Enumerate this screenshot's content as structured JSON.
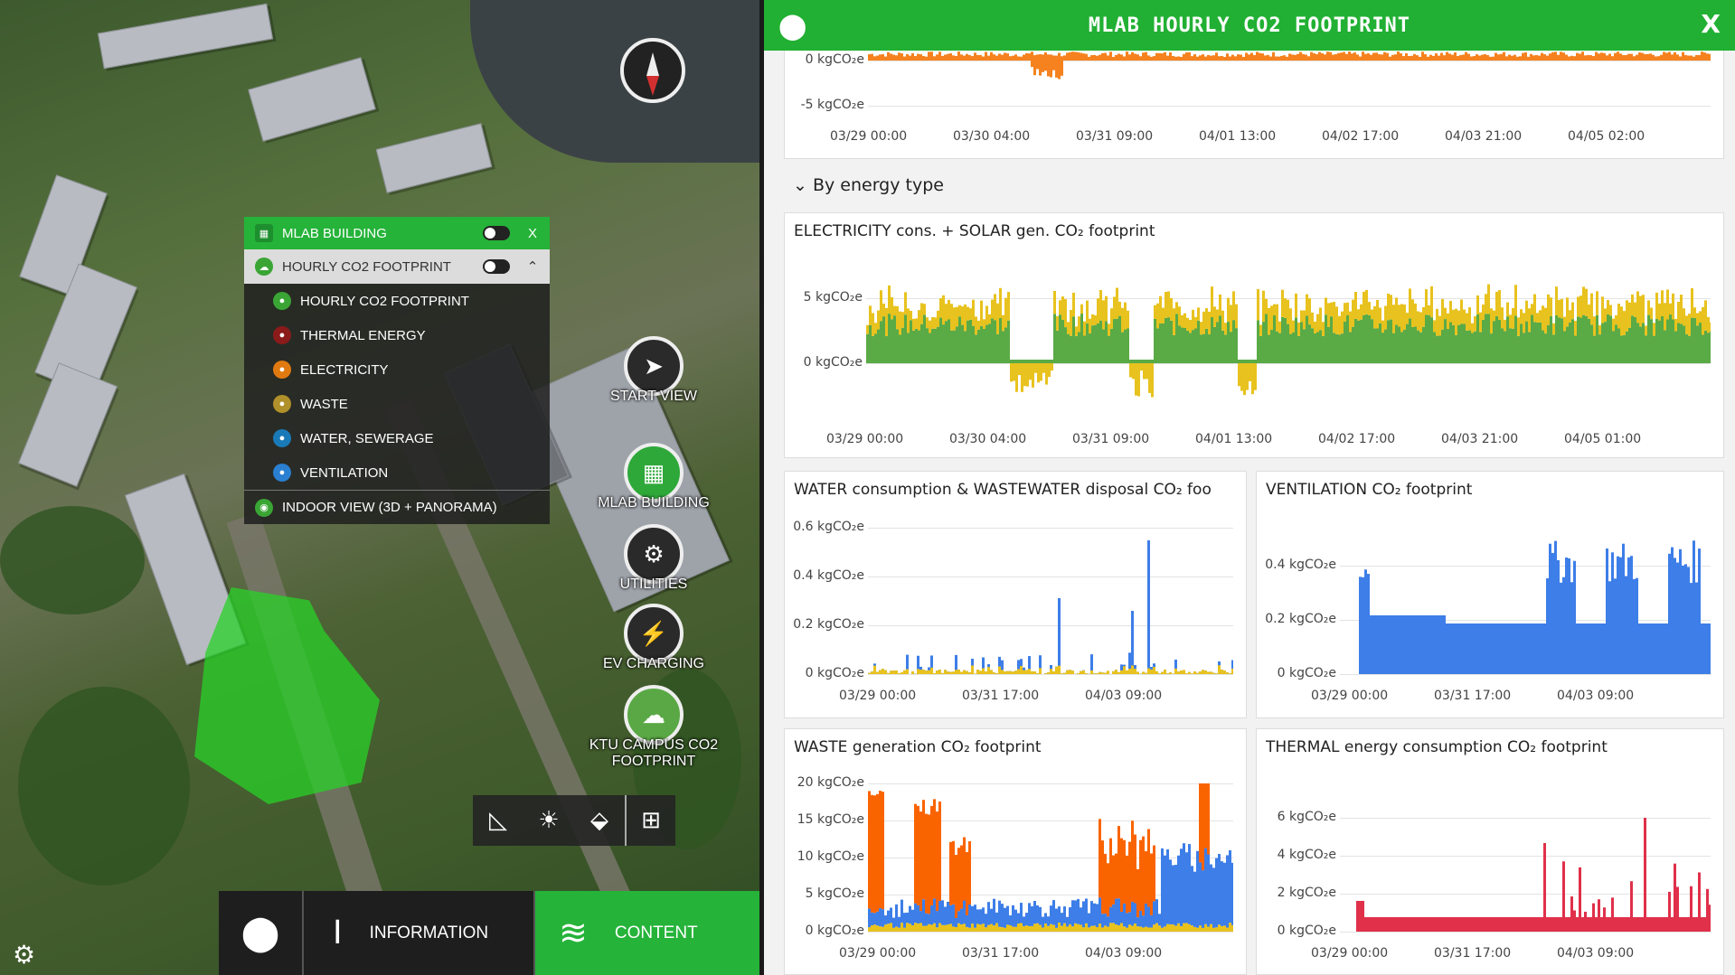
{
  "menu": {
    "header": "MLAB BUILDING",
    "header_close": "X",
    "sub": "HOURLY CO2 FOOTPRINT",
    "items": [
      {
        "label": "HOURLY CO2 FOOTPRINT",
        "icon": "recycle-icon",
        "color": "#3aa535"
      },
      {
        "label": "THERMAL ENERGY",
        "icon": "radiator-icon",
        "color": "#8b1a1a"
      },
      {
        "label": "ELECTRICITY",
        "icon": "lightning-icon",
        "color": "#e07a10"
      },
      {
        "label": "WASTE",
        "icon": "trash-icon",
        "color": "#b0902a"
      },
      {
        "label": "WATER, SEWERAGE",
        "icon": "water-icon",
        "color": "#1a7ab8"
      },
      {
        "label": "VENTILATION",
        "icon": "fan-icon",
        "color": "#2a7fd0"
      }
    ],
    "last": "INDOOR VIEW (3D + PANORAMA)"
  },
  "side_buttons": [
    {
      "label": "START VIEW",
      "icon": "paper-plane-icon",
      "glyph": "➤"
    },
    {
      "label": "MLAB BUILDING",
      "icon": "building-icon",
      "glyph": "▦"
    },
    {
      "label": "UTILITIES",
      "icon": "utilities-icon",
      "glyph": "⚙"
    },
    {
      "label": "EV CHARGING",
      "icon": "ev-charger-icon",
      "glyph": "⚡"
    },
    {
      "label": "KTU CAMPUS CO2 FOOTPRINT",
      "icon": "co2-cloud-icon",
      "glyph": "☁"
    }
  ],
  "bottom": {
    "information": "INFORMATION",
    "content": "CONTENT"
  },
  "panel": {
    "title": "MLAB HOURLY CO2 FOOTPRINT",
    "close": "X",
    "section": "By energy type",
    "top": {
      "y_ticks": [
        "0 kgCO₂e",
        "-5 kgCO₂e"
      ],
      "x_ticks": [
        "03/29 00:00",
        "03/30 04:00",
        "03/31 09:00",
        "04/01 13:00",
        "04/02 17:00",
        "04/03 21:00",
        "04/05 02:00"
      ]
    },
    "electricity": {
      "title": "ELECTRICITY cons. + SOLAR gen. CO₂ footprint",
      "y_ticks": [
        "5 kgCO₂e",
        "0 kgCO₂e"
      ],
      "x_ticks": [
        "03/29 00:00",
        "03/30 04:00",
        "03/31 09:00",
        "04/01 13:00",
        "04/02 17:00",
        "04/03 21:00",
        "04/05 01:00"
      ]
    },
    "water": {
      "title": "WATER consumption & WASTEWATER disposal CO₂ foo",
      "y_ticks": [
        "0.6 kgCO₂e",
        "0.4 kgCO₂e",
        "0.2 kgCO₂e",
        "0 kgCO₂e"
      ],
      "x_ticks": [
        "03/29 00:00",
        "03/31 17:00",
        "04/03 09:00"
      ]
    },
    "ventilation": {
      "title": "VENTILATION CO₂ footprint",
      "y_ticks": [
        "0.4 kgCO₂e",
        "0.2 kgCO₂e",
        "0 kgCO₂e"
      ],
      "x_ticks": [
        "03/29 00:00",
        "03/31 17:00",
        "04/03 09:00"
      ]
    },
    "waste": {
      "title": "WASTE generation CO₂ footprint",
      "y_ticks": [
        "20 kgCO₂e",
        "15 kgCO₂e",
        "10 kgCO₂e",
        "5 kgCO₂e",
        "0 kgCO₂e"
      ],
      "x_ticks": [
        "03/29 00:00",
        "03/31 17:00",
        "04/03 09:00"
      ]
    },
    "thermal": {
      "title": "THERMAL energy consumption CO₂ footprint",
      "y_ticks": [
        "6 kgCO₂e",
        "4 kgCO₂e",
        "2 kgCO₂e",
        "0 kgCO₂e"
      ],
      "x_ticks": [
        "03/29 00:00",
        "03/31 17:00",
        "04/03 09:00"
      ]
    }
  },
  "colors": {
    "green": "#25b339",
    "orange": "#f5821f",
    "solar": "#e8c21e",
    "elec": "#5aaa46",
    "blue": "#3d7ee8",
    "waste_orange": "#fa6400",
    "red": "#e0304a"
  }
}
